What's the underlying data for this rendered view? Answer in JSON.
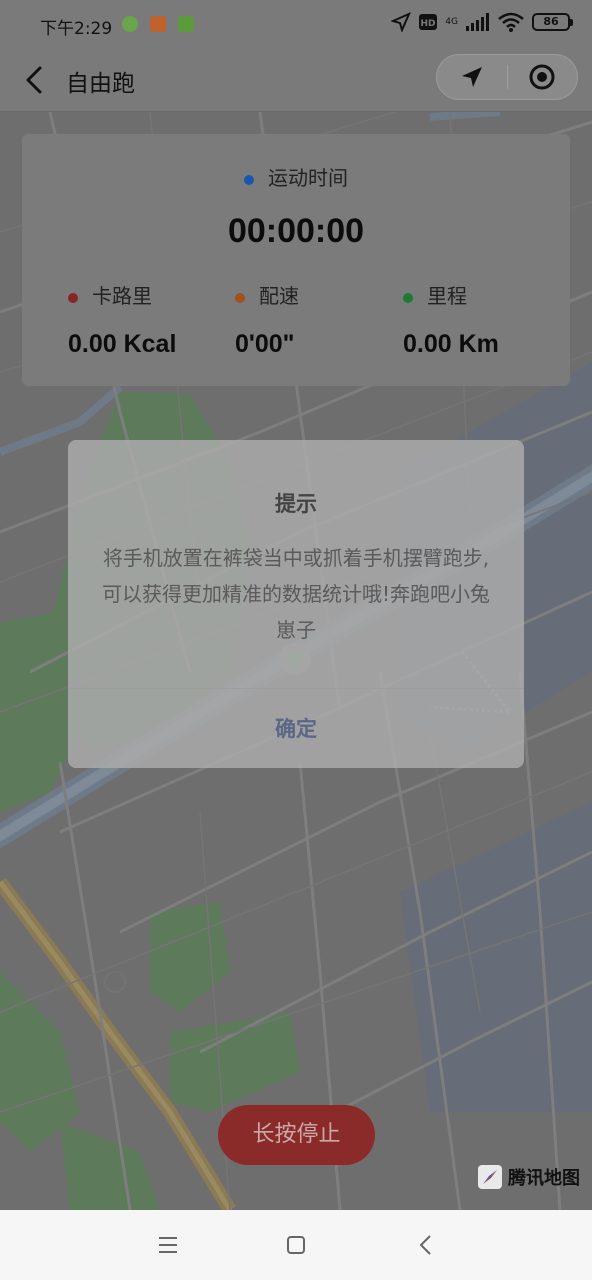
{
  "status_bar": {
    "time": "下午2:29",
    "network": "4G",
    "battery": "86"
  },
  "navbar": {
    "title": "自由跑",
    "back_icon": "chevron-left-icon",
    "capsule_left_icon": "location-arrow-icon",
    "capsule_right_icon": "target-icon"
  },
  "stats": {
    "duration_label": "运动时间",
    "duration_value": "00:00:00",
    "calories_label": "卡路里",
    "calories_value": "0.00 Kcal",
    "pace_label": "配速",
    "pace_value": "0'00\"",
    "distance_label": "里程",
    "distance_value": "0.00 Km"
  },
  "colors": {
    "duration_dot": "#1a55b0",
    "calories_dot": "#8a2424",
    "pace_dot": "#a0521c",
    "distance_dot": "#1e7a32",
    "stop_button": "#8a2b2a"
  },
  "dialog": {
    "title": "提示",
    "body": "将手机放置在裤袋当中或抓着手机摆臂跑步,可以获得更加精准的数据统计哦!奔跑吧小兔崽子",
    "confirm": "确定"
  },
  "stop_button": {
    "label": "长按停止"
  },
  "map": {
    "attribution": "腾讯地图"
  }
}
